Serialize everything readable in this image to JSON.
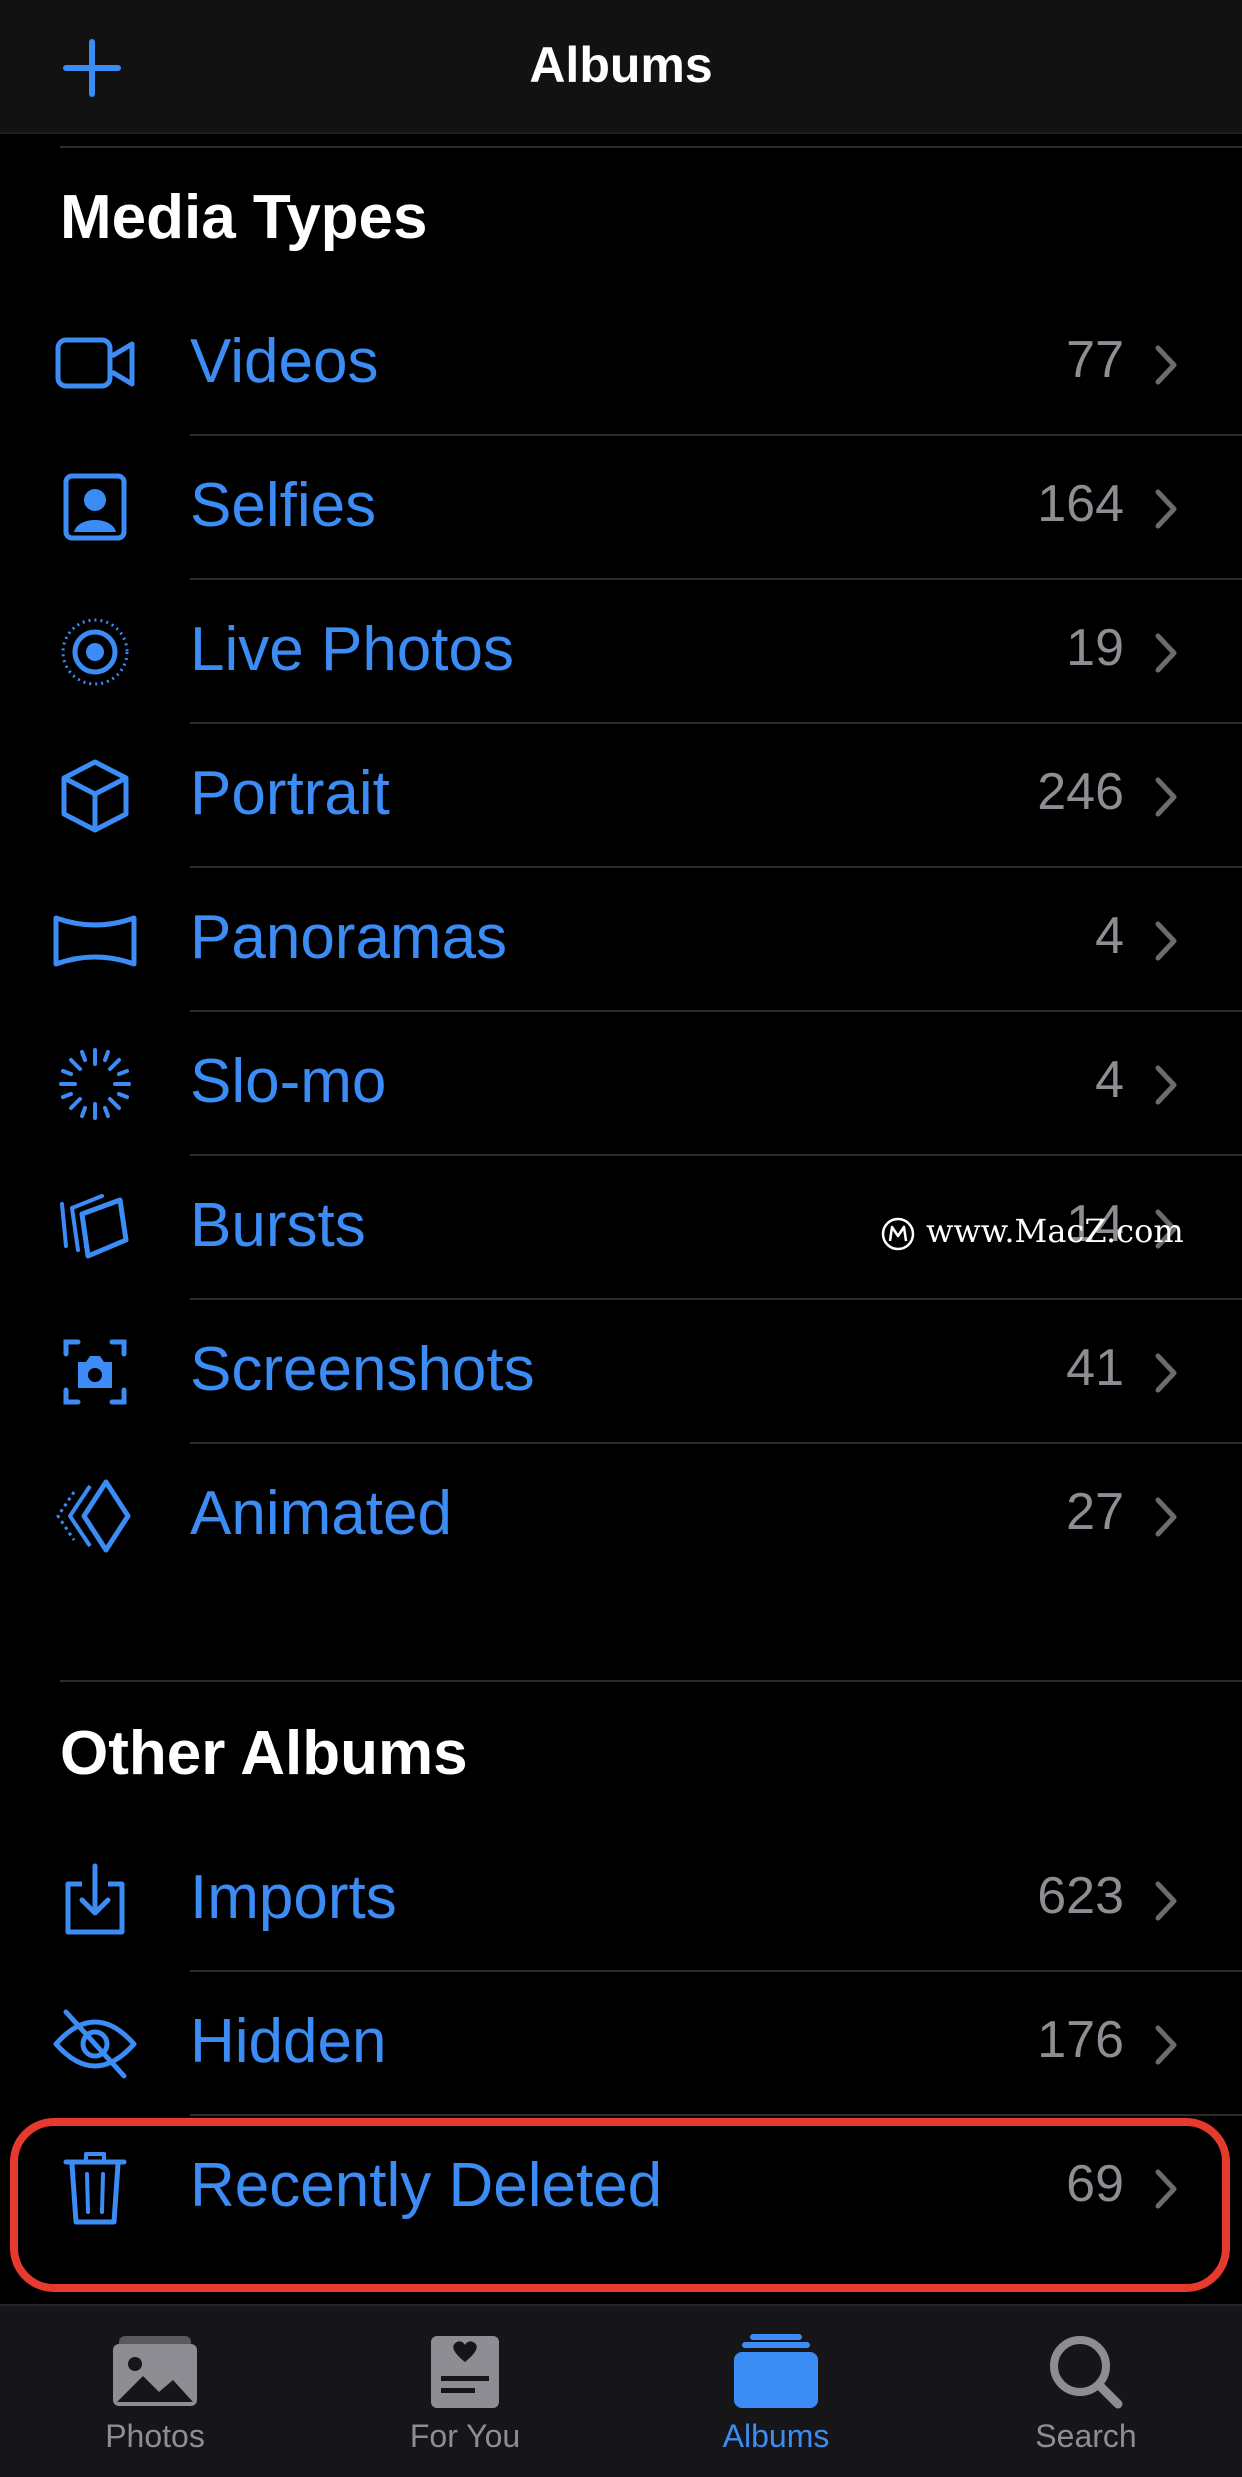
{
  "header": {
    "title": "Albums",
    "add_icon": "plus-icon"
  },
  "colors": {
    "accent": "#3c8cf6",
    "secondary_text": "#8d8d93",
    "highlight_border": "#e63a2e"
  },
  "media_types": {
    "title": "Media Types",
    "items": [
      {
        "label": "Videos",
        "count": "77",
        "icon": "video-camera-icon"
      },
      {
        "label": "Selfies",
        "count": "164",
        "icon": "selfie-portrait-icon"
      },
      {
        "label": "Live Photos",
        "count": "19",
        "icon": "live-photo-icon"
      },
      {
        "label": "Portrait",
        "count": "246",
        "icon": "cube-icon"
      },
      {
        "label": "Panoramas",
        "count": "4",
        "icon": "panorama-icon"
      },
      {
        "label": "Slo-mo",
        "count": "4",
        "icon": "slo-mo-icon"
      },
      {
        "label": "Bursts",
        "count": "14",
        "icon": "bursts-icon"
      },
      {
        "label": "Screenshots",
        "count": "41",
        "icon": "screenshot-icon"
      },
      {
        "label": "Animated",
        "count": "27",
        "icon": "animated-icon"
      }
    ]
  },
  "other_albums": {
    "title": "Other Albums",
    "items": [
      {
        "label": "Imports",
        "count": "623",
        "icon": "import-icon"
      },
      {
        "label": "Hidden",
        "count": "176",
        "icon": "eye-slash-icon"
      },
      {
        "label": "Recently Deleted",
        "count": "69",
        "icon": "trash-icon"
      }
    ]
  },
  "tabs": [
    {
      "label": "Photos",
      "icon": "photos-icon",
      "active": false
    },
    {
      "label": "For You",
      "icon": "for-you-icon",
      "active": false
    },
    {
      "label": "Albums",
      "icon": "albums-icon",
      "active": true
    },
    {
      "label": "Search",
      "icon": "search-icon",
      "active": false
    }
  ],
  "watermark": {
    "text": "www.MacZ.com"
  }
}
